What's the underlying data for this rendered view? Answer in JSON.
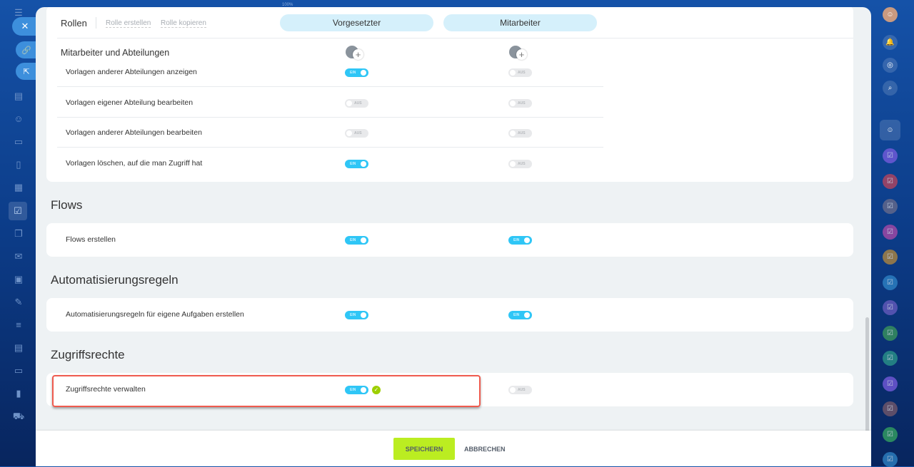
{
  "zoom_label": "100%",
  "header": {
    "title": "Rollen",
    "create_role": "Rolle erstellen",
    "copy_role": "Rolle kopieren",
    "roles": [
      "Vorgesetzter",
      "Mitarbeiter"
    ]
  },
  "section_employees": {
    "title": "Mitarbeiter und Abteilungen",
    "rows": [
      {
        "label": "Vorlagen anderer Abteilungen anzeigen",
        "values": [
          "EIN",
          "AUS"
        ]
      },
      {
        "label": "Vorlagen eigener Abteilung bearbeiten",
        "values": [
          "AUS",
          "AUS"
        ]
      },
      {
        "label": "Vorlagen anderer Abteilungen bearbeiten",
        "values": [
          "AUS",
          "AUS"
        ]
      },
      {
        "label": "Vorlagen löschen, auf die man Zugriff hat",
        "values": [
          "EIN",
          "AUS"
        ]
      }
    ]
  },
  "groups": [
    {
      "title": "Flows",
      "row": {
        "label": "Flows erstellen",
        "values": [
          "EIN",
          "EIN"
        ]
      }
    },
    {
      "title": "Automatisierungsregeln",
      "row": {
        "label": "Automatisierungsregeln für eigene Aufgaben erstellen",
        "values": [
          "EIN",
          "EIN"
        ]
      }
    },
    {
      "title": "Zugriffsrechte",
      "row": {
        "label": "Zugriffsrechte verwalten",
        "values": [
          "EIN",
          "AUS"
        ]
      }
    }
  ],
  "footer": {
    "save": "SPEICHERN",
    "cancel": "ABBRECHEN"
  },
  "right_sidebar_colors": [
    "#7a5ce0",
    "#c0445a",
    "#6d6d8a",
    "#b04aa8",
    "#b98a3a",
    "#2f86c8",
    "#6a5cc0",
    "#3c9a5a",
    "#2c9a8a",
    "#7a5ce0",
    "#7a5a6a",
    "#35a860",
    "#2f86c8"
  ]
}
